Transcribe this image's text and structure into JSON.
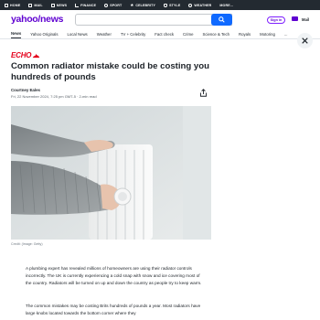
{
  "topbar": {
    "items": [
      {
        "label": "HOME",
        "icon": "home-icon"
      },
      {
        "label": "MAIL",
        "icon": "mail-icon"
      },
      {
        "label": "NEWS",
        "icon": "news-icon"
      },
      {
        "label": "FINANCE",
        "icon": "finance-icon"
      },
      {
        "label": "SPORT",
        "icon": "sport-icon"
      },
      {
        "label": "CELEBRITY",
        "icon": "celebrity-icon"
      },
      {
        "label": "STYLE",
        "icon": "style-icon"
      },
      {
        "label": "WEATHER",
        "icon": "weather-icon"
      },
      {
        "label": "MORE...",
        "icon": ""
      }
    ]
  },
  "header": {
    "logo_main": "yahoo",
    "logo_slash": "/",
    "logo_section": "news",
    "search_placeholder": "",
    "signin_label": "Sign in",
    "mail_label": "Mail"
  },
  "nav": {
    "items": [
      "News",
      "Yahoo Originals",
      "Local News",
      "Weather",
      "TV + Celebrity",
      "Fact check",
      "Crime",
      "Science & Tech",
      "Royals",
      "Motoring",
      "..."
    ]
  },
  "article": {
    "publisher": "ECHO",
    "headline": "Common radiator mistake could be costing you hundreds of pounds",
    "author": "Courtney Eales",
    "meta": "Fri, 22 November 2024, 7:25 pm GMT-5  ·  2-min read",
    "image_credit": "Credit: (Image: Getty)",
    "paragraphs": [
      "A plumbing expert has revealed millions of homeowners are using their radiator controls incorrectly. The UK is currently experiencing a cold snap with snow and ice covering most of the country. Radiators will be turned on up and down the country as people try to keep warm.",
      "The common mistakes may be costing Brits hundreds of pounds a year. Most radiators have large knobs located towards the bottom corner where they"
    ]
  },
  "colors": {
    "yahoo_purple": "#5f01d1",
    "search_blue": "#0f69ff",
    "echo_red": "#e4001b",
    "topbar_bg": "#232a31"
  }
}
